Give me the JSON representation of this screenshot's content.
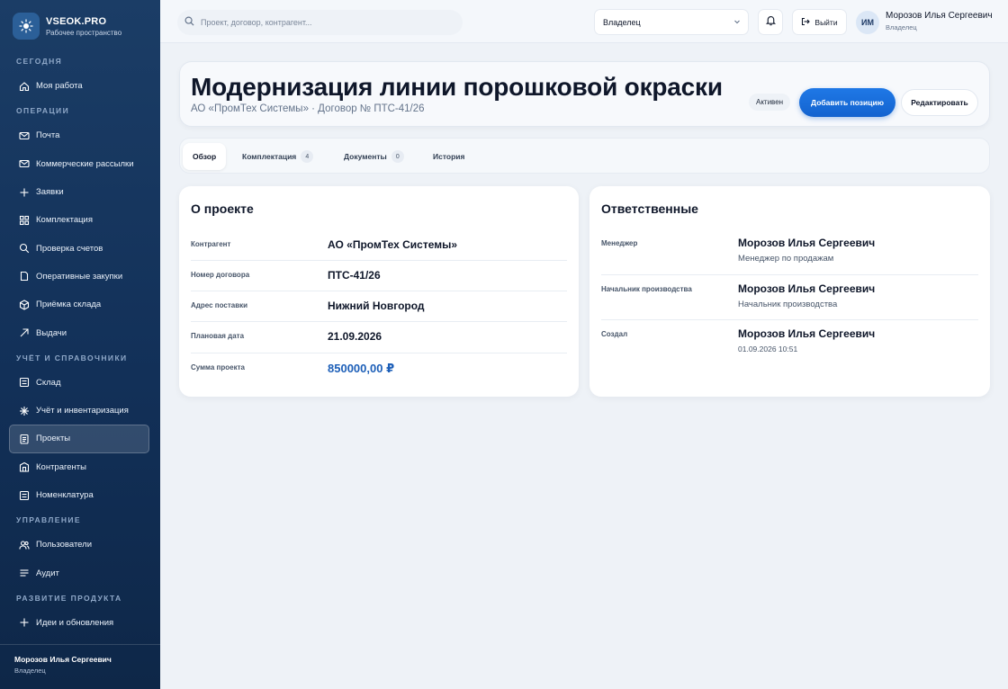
{
  "brand": {
    "name": "VSEOK.PRO",
    "subtitle": "Рабочее пространство"
  },
  "sidebar": {
    "sections": {
      "today": "СЕГОДНЯ",
      "operations": "ОПЕРАЦИИ",
      "accounting": "УЧЁТ И СПРАВОЧНИКИ",
      "management": "УПРАВЛЕНИЕ",
      "product": "РАЗВИТИЕ ПРОДУКТА"
    },
    "items": {
      "my_work": "Моя работа",
      "mail": "Почта",
      "mailings": "Коммерческие рассылки",
      "requests": "Заявки",
      "kits": "Комплектация",
      "invoice_check": "Проверка счетов",
      "purchases": "Оперативные закупки",
      "warehouse_receipt": "Приёмка склада",
      "issues": "Выдачи",
      "warehouse": "Склад",
      "inventory": "Учёт и инвентаризация",
      "projects": "Проекты",
      "counterparties": "Контрагенты",
      "nomenclature": "Номенклатура",
      "users": "Пользователи",
      "audit": "Аудит",
      "ideas": "Идеи и обновления"
    },
    "footer": {
      "name": "Морозов Илья Сергеевич",
      "role": "Владелец"
    }
  },
  "topbar": {
    "search_placeholder": "Проект, договор, контрагент...",
    "role_value": "Владелец",
    "logout_label": "Выйти",
    "avatar_initials": "ИМ",
    "user_name": "Морозов Илья Сергеевич",
    "user_role": "Владелец"
  },
  "project": {
    "title": "Модернизация линии порошковой окраски",
    "subtitle": "АО «ПромТех Системы» · Договор № ПТС-41/26",
    "status": "Активен",
    "add_position_label": "Добавить позицию",
    "edit_label": "Редактировать"
  },
  "tabs": [
    {
      "label": "Обзор"
    },
    {
      "label": "Комплектация",
      "count": "4"
    },
    {
      "label": "Документы",
      "count": "0"
    },
    {
      "label": "История"
    }
  ],
  "about": {
    "title": "О проекте",
    "rows": [
      {
        "label": "Контрагент",
        "value": "АО «ПромТех Системы»"
      },
      {
        "label": "Номер договора",
        "value": "ПТС-41/26"
      },
      {
        "label": "Адрес поставки",
        "value": "Нижний Новгород"
      },
      {
        "label": "Плановая дата",
        "value": "21.09.2026"
      },
      {
        "label": "Сумма проекта",
        "value": "850000,00 ₽"
      }
    ]
  },
  "responsible": {
    "title": "Ответственные",
    "rows": [
      {
        "label": "Менеджер",
        "name": "Морозов Илья Сергеевич",
        "detail": "Менеджер по продажам"
      },
      {
        "label": "Начальник производства",
        "name": "Морозов Илья Сергеевич",
        "detail": "Начальник производства"
      },
      {
        "label": "Создал",
        "name": "Морозов Илья Сергеевич",
        "detail": "01.09.2026 10:51"
      }
    ]
  },
  "colors": {
    "accent": "#1363cf",
    "sidebar": "#123058",
    "money": "#1d5fb8"
  }
}
